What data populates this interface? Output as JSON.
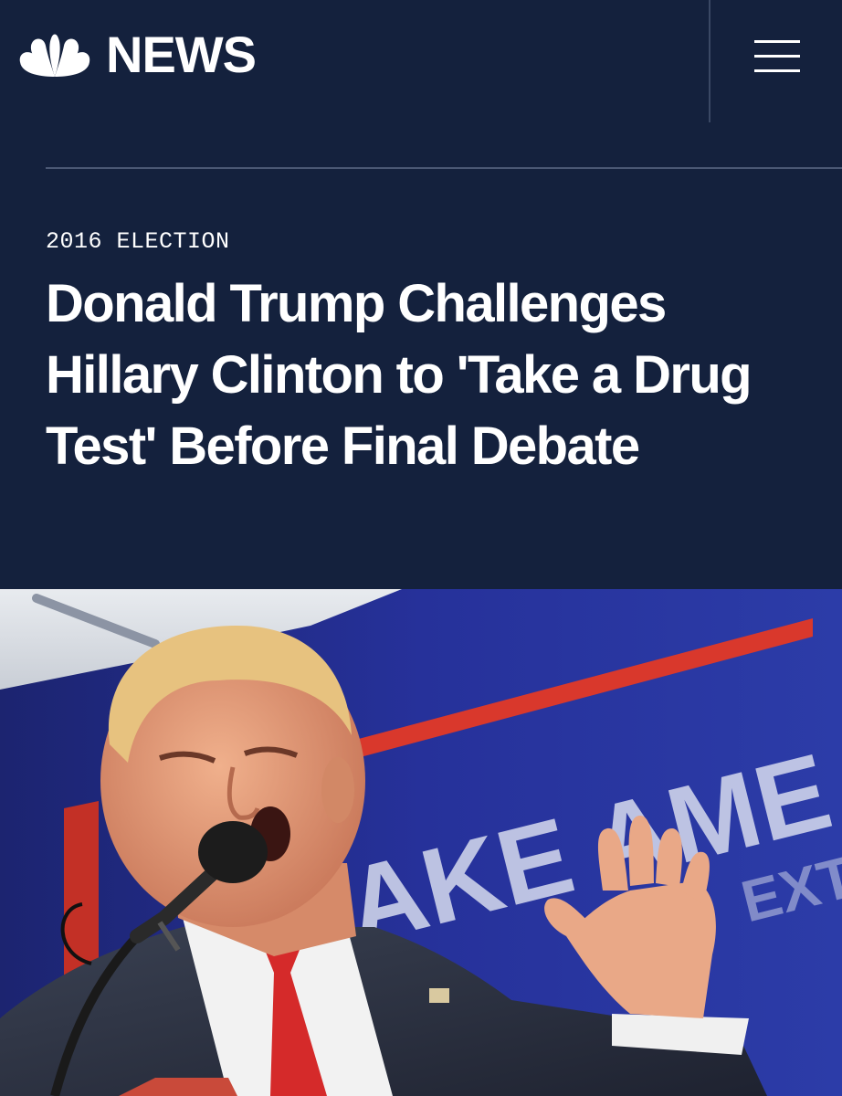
{
  "brand": {
    "name": "NEWS",
    "logo_icon": "peacock-icon"
  },
  "nav": {
    "menu_icon": "hamburger-menu-icon"
  },
  "article": {
    "section": "2016 ELECTION",
    "headline": "Donald Trump Challenges Hillary Clinton to 'Take a Drug Test' Before Final Debate"
  },
  "photo": {
    "sign_text": "AKE AME",
    "sign_text_2": "EXT"
  },
  "colors": {
    "background": "#14213d",
    "text": "#ffffff",
    "sign_blue": "#2a3a9a",
    "sign_red": "#d9382c",
    "tie_red": "#d52a2a"
  }
}
